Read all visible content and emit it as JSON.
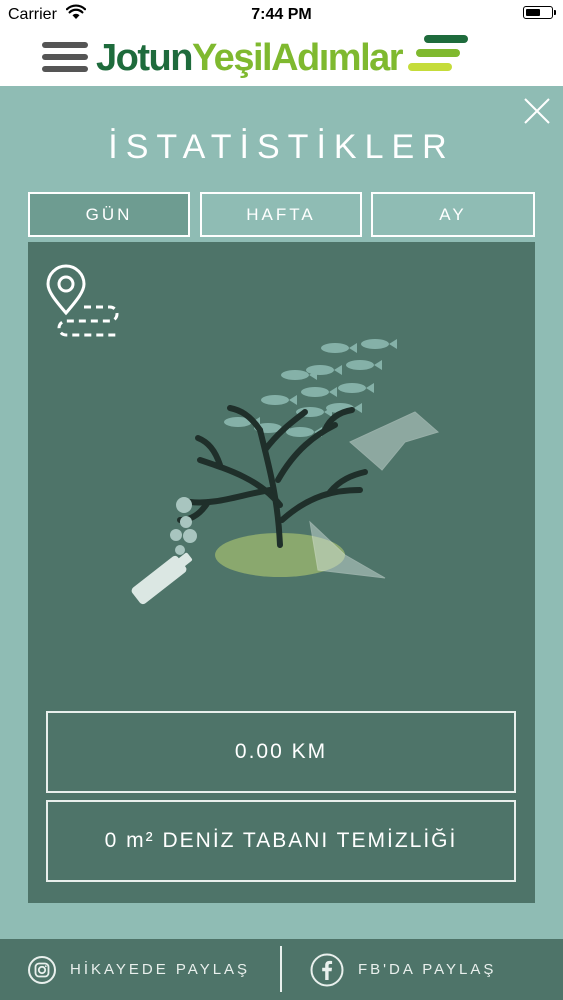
{
  "status_bar": {
    "carrier": "Carrier",
    "time": "7:44 PM"
  },
  "header": {
    "brand_part1": "Jotun",
    "brand_part2": "YeşilAdımlar",
    "colors": {
      "brand_dark": "#1e6b3c",
      "brand_light": "#7fb92f"
    }
  },
  "page": {
    "title": "İSTATİSTİKLER"
  },
  "tabs": [
    {
      "label": "GÜN",
      "active": true
    },
    {
      "label": "HAFTA",
      "active": false
    },
    {
      "label": "AY",
      "active": false
    }
  ],
  "stats": {
    "distance": "0.00 KM",
    "seabed_cleaning": "0 m² DENİZ TABANI TEMİZLİĞİ"
  },
  "footer": {
    "instagram_label": "HİKAYEDE PAYLAŞ",
    "facebook_label": "FB'DA PAYLAŞ"
  },
  "colors": {
    "panel_bg": "#8fbcb4",
    "card_bg": "#4e7469",
    "footer_bg": "#4e7469",
    "active_tab": "#6e9c91"
  },
  "icons": [
    "menu-icon",
    "brand-logo-icon",
    "close-icon",
    "route-pin-icon",
    "instagram-icon",
    "facebook-icon"
  ]
}
